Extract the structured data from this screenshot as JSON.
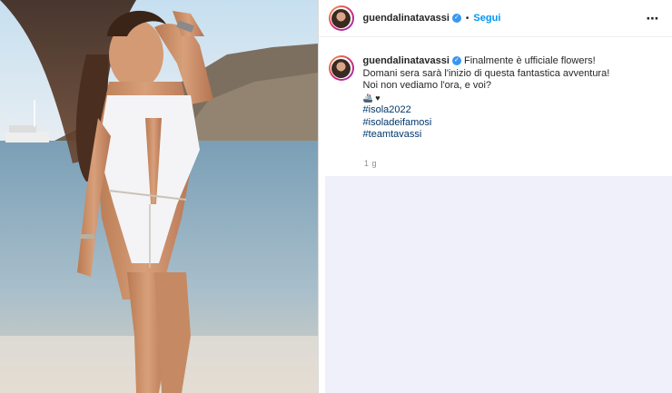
{
  "header": {
    "username": "guendalinatavassi",
    "separator": "•",
    "follow_label": "Segui",
    "more_icon": "⋯"
  },
  "caption": {
    "username": "guendalinatavassi",
    "lines": [
      "Finalmente è ufficiale flowers!",
      "Domani sera sarà l'inizio di questa fantastica avventura!",
      "Noi non vediamo l'ora, e voi?"
    ],
    "emoji_line": "🚢 ♥",
    "hashtags": [
      "#isola2022",
      "#isoladeifamosi",
      "#teamtavassi"
    ],
    "time": "1 g"
  },
  "colors": {
    "link": "#0095f6",
    "hashtag": "#00376b",
    "verified": "#3897f0",
    "panel": "#f0f0fa"
  }
}
